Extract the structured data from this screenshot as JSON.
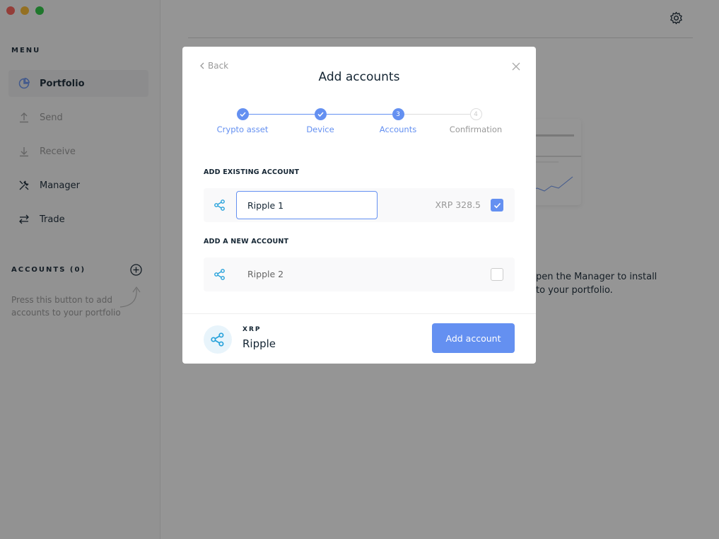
{
  "sidebar": {
    "menu_title": "MENU",
    "items": [
      {
        "label": "Portfolio",
        "icon": "pie-chart-icon"
      },
      {
        "label": "Send",
        "icon": "arrow-up-icon"
      },
      {
        "label": "Receive",
        "icon": "arrow-down-icon"
      },
      {
        "label": "Manager",
        "icon": "tools-icon"
      },
      {
        "label": "Trade",
        "icon": "swap-icon"
      }
    ],
    "accounts_title": "ACCOUNTS (0)",
    "hint": "Press this button to add accounts to your portfolio"
  },
  "background": {
    "text": "pen the Manager to install\nto your portfolio."
  },
  "modal": {
    "back_label": "Back",
    "title": "Add accounts",
    "steps": [
      {
        "label": "Crypto asset",
        "state": "done"
      },
      {
        "label": "Device",
        "state": "done"
      },
      {
        "label": "Accounts",
        "state": "current",
        "number": "3"
      },
      {
        "label": "Confirmation",
        "state": "todo",
        "number": "4"
      }
    ],
    "existing_title": "ADD EXISTING ACCOUNT",
    "existing_account": {
      "name": "Ripple 1",
      "balance": "XRP 328.5",
      "checked": true
    },
    "new_title": "ADD A NEW ACCOUNT",
    "new_account": {
      "name": "Ripple 2",
      "checked": false
    },
    "footer": {
      "ticker": "XRP",
      "name": "Ripple",
      "button_label": "Add account"
    }
  },
  "colors": {
    "accent": "#6490f1",
    "xrp": "#27a2db"
  }
}
